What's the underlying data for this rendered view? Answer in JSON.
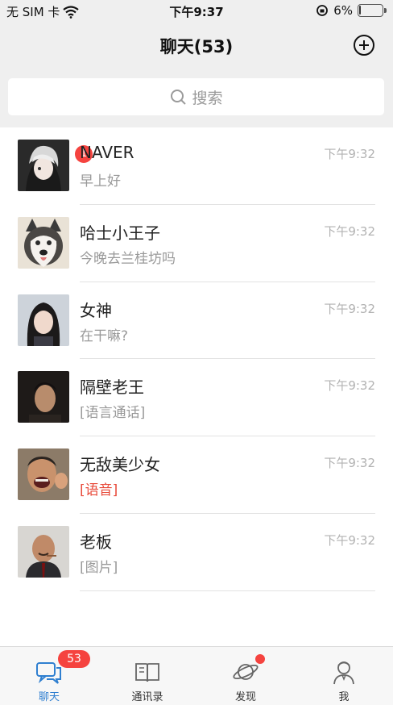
{
  "status_bar": {
    "carrier": "无 SIM 卡",
    "time": "下午9:37",
    "battery": "6%",
    "battery_level": 0.06
  },
  "header": {
    "title": "聊天(53)",
    "add_icon": "plus-circle-icon"
  },
  "search": {
    "placeholder": "搜索",
    "icon": "search-icon"
  },
  "chats": [
    {
      "name": "NAVER",
      "preview": "早上好",
      "time": "下午9:32",
      "unread": "1"
    },
    {
      "name": "哈士小王子",
      "preview": "今晚去兰桂坊吗",
      "time": "下午9:32"
    },
    {
      "name": "女神",
      "preview": "在干嘛?",
      "time": "下午9:32"
    },
    {
      "name": "隔壁老王",
      "preview": "[语言通话]",
      "time": "下午9:32"
    },
    {
      "name": "无敌美少女",
      "preview": "[语音]",
      "time": "下午9:32",
      "preview_highlight": "#e84a3a"
    },
    {
      "name": "老板",
      "preview": "[图片]",
      "time": "下午9:32"
    }
  ],
  "tabs": [
    {
      "label": "聊天",
      "badge": "53",
      "icon": "chat-bubbles-icon",
      "active": true
    },
    {
      "label": "通讯录",
      "icon": "address-book-icon"
    },
    {
      "label": "发现",
      "icon": "planet-icon",
      "dot": true
    },
    {
      "label": "我",
      "icon": "person-icon"
    }
  ],
  "colors": {
    "accent": "#2f7fd0",
    "badge": "#f5433f",
    "background": "#efefef"
  }
}
